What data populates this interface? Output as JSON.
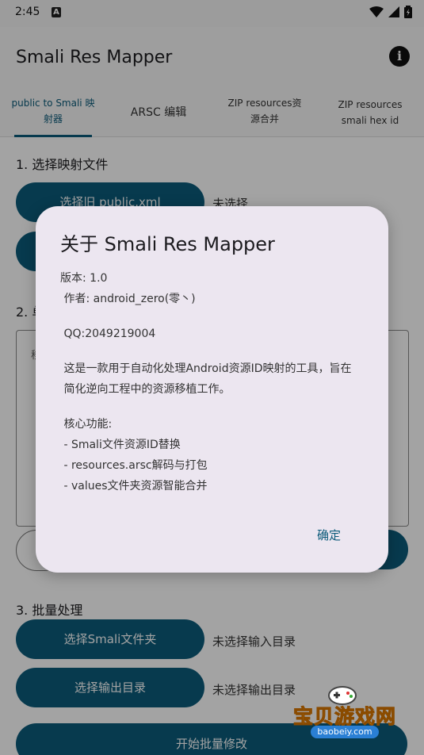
{
  "status_bar": {
    "time": "2:45",
    "notif_icon_letter": "A"
  },
  "app": {
    "title": "Smali Res Mapper"
  },
  "tabs": [
    {
      "line1": "public to Smali 映",
      "line2": "射器",
      "active": true
    },
    {
      "line1": "ARSC 编辑",
      "line2": "",
      "active": false
    },
    {
      "line1": "ZIP resources资",
      "line2": "源合并",
      "active": false
    },
    {
      "line1": "ZIP resources",
      "line2": "smali hex id",
      "active": false
    }
  ],
  "main": {
    "section1_title": "1. 选择映射文件",
    "select_old_button": "选择旧 public.xml",
    "old_status": "未选择",
    "section2_title_partial": "2. 单",
    "field_hint_partial": "移",
    "section3_title": "3. 批量处理",
    "select_smali_button": "选择Smali文件夹",
    "smali_status": "未选择输入目录",
    "select_output_button": "选择输出目录",
    "output_status": "未选择输出目录",
    "start_button": "开始批量修改"
  },
  "dialog": {
    "title": "关于 Smali Res Mapper",
    "version": "版本: 1.0",
    "author": " 作者: android_zero(零丶)",
    "qq": " QQ:2049219004",
    "desc_line1": " 这是一款用于自动化处理Android资源ID映射的工具，旨在",
    "desc_line2": " 简化逆向工程中的资源移植工作。",
    "features_title": " 核心功能:",
    "feature1": " - Smali文件资源ID替换",
    "feature2": " - resources.arsc解码与打包",
    "feature3": " - values文件夹资源智能合并",
    "confirm_label": "确定"
  },
  "watermark": {
    "text_cn": "宝贝游戏网",
    "text_en": "baobeiy.com"
  },
  "colors": {
    "accent": "#0b5b7a",
    "dialog_bg": "#ece6f0"
  }
}
